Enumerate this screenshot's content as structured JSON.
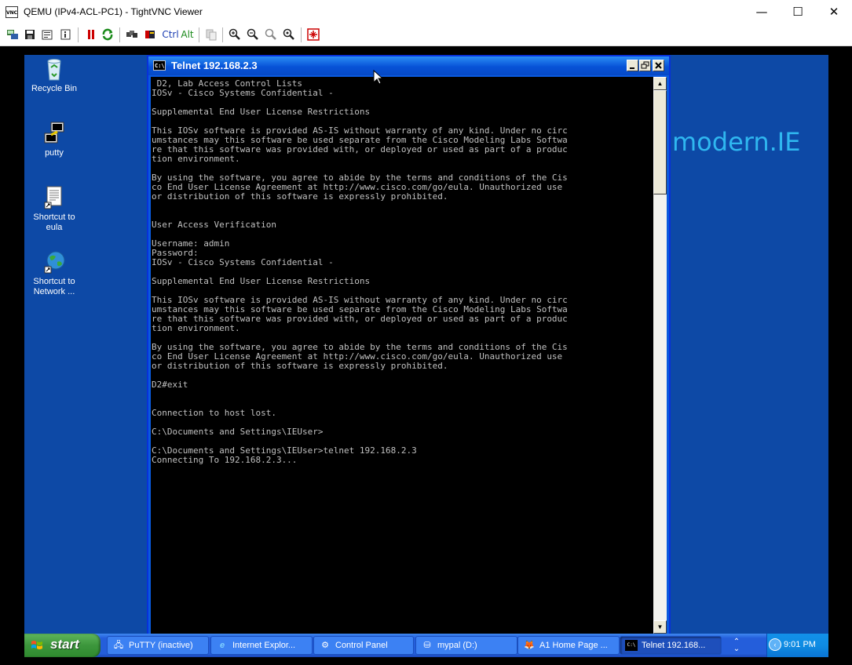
{
  "viewer": {
    "title": "QEMU (IPv4-ACL-PC1) - TightVNC Viewer",
    "app_icon_text": "VNC",
    "minimize": "—",
    "maximize": "☐",
    "close": "✕",
    "toolbar": {
      "ctrl_label": "Ctrl",
      "alt_label": "Alt",
      "icons": [
        "new-connection-icon",
        "save-icon",
        "options-icon",
        "info-icon",
        "pause-icon",
        "refresh-icon",
        "ctrl-alt-del-icon",
        "ctrl-esc-icon",
        "ctrl-key-icon",
        "alt-key-icon",
        "transfer-icon",
        "zoom-in-icon",
        "zoom-out-icon",
        "zoom-100-icon",
        "zoom-auto-icon",
        "fullscreen-icon"
      ]
    }
  },
  "desktop": {
    "icons": [
      {
        "label": "Recycle Bin"
      },
      {
        "label": "putty"
      },
      {
        "label": "Shortcut to eula"
      },
      {
        "label": "Shortcut to Network ..."
      }
    ],
    "wallpaper_text": "modern.IE"
  },
  "telnet": {
    "title": "Telnet 192.168.2.3",
    "icon_text": "C:\\",
    "console_lines": [
      " D2, Lab Access Control Lists",
      "IOSv - Cisco Systems Confidential -",
      "",
      "Supplemental End User License Restrictions",
      "",
      "This IOSv software is provided AS-IS without warranty of any kind. Under no circ",
      "umstances may this software be used separate from the Cisco Modeling Labs Softwa",
      "re that this software was provided with, or deployed or used as part of a produc",
      "tion environment.",
      "",
      "By using the software, you agree to abide by the terms and conditions of the Cis",
      "co End User License Agreement at http://www.cisco.com/go/eula. Unauthorized use",
      "or distribution of this software is expressly prohibited.",
      "",
      "",
      "User Access Verification",
      "",
      "Username: admin",
      "Password:",
      "IOSv - Cisco Systems Confidential -",
      "",
      "Supplemental End User License Restrictions",
      "",
      "This IOSv software is provided AS-IS without warranty of any kind. Under no circ",
      "umstances may this software be used separate from the Cisco Modeling Labs Softwa",
      "re that this software was provided with, or deployed or used as part of a produc",
      "tion environment.",
      "",
      "By using the software, you agree to abide by the terms and conditions of the Cis",
      "co End User License Agreement at http://www.cisco.com/go/eula. Unauthorized use",
      "or distribution of this software is expressly prohibited.",
      "",
      "D2#exit",
      "",
      "",
      "Connection to host lost.",
      "",
      "C:\\Documents and Settings\\IEUser>",
      "",
      "C:\\Documents and Settings\\IEUser>telnet 192.168.2.3",
      "Connecting To 192.168.2.3..."
    ]
  },
  "taskbar": {
    "start_label": "start",
    "tasks": [
      {
        "label": "PuTTY (inactive)",
        "icon": "putty-icon",
        "active": false
      },
      {
        "label": "Internet Explor...",
        "icon": "ie-icon",
        "active": false
      },
      {
        "label": "Control Panel",
        "icon": "control-panel-icon",
        "active": false
      },
      {
        "label": "mypal (D:)",
        "icon": "drive-icon",
        "active": false
      },
      {
        "label": "A1 Home Page ...",
        "icon": "browser-icon",
        "active": false
      },
      {
        "label": "Telnet 192.168...",
        "icon": "cmd-icon",
        "active": true
      }
    ],
    "clock": "9:01 PM"
  }
}
